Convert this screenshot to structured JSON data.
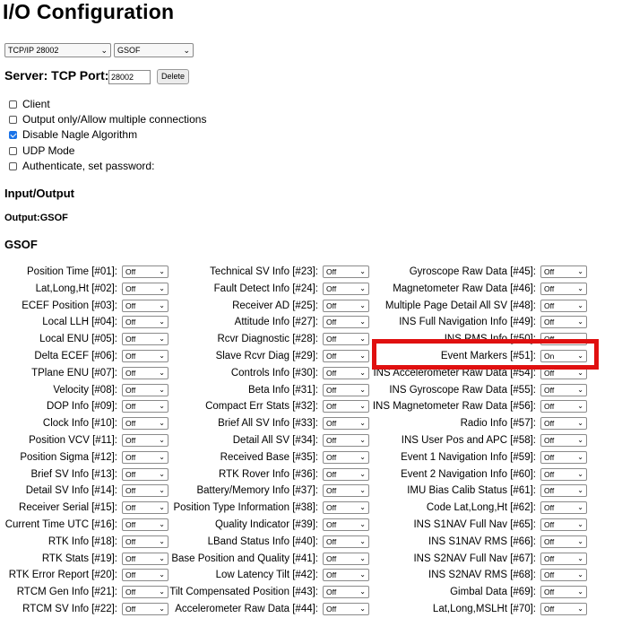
{
  "page": {
    "title": "I/O Configuration"
  },
  "top_selects": {
    "port": "TCP/IP 28002",
    "format": "GSOF"
  },
  "server": {
    "label": "Server: TCP Port:",
    "port_value": "28002",
    "delete_label": "Delete"
  },
  "checkboxes": [
    {
      "label": "Client",
      "checked": false
    },
    {
      "label": "Output only/Allow multiple connections",
      "checked": false
    },
    {
      "label": "Disable Nagle Algorithm",
      "checked": true
    },
    {
      "label": "UDP Mode",
      "checked": false
    },
    {
      "label": "Authenticate, set password:",
      "checked": false
    }
  ],
  "sections": {
    "io": "Input/Output",
    "output": "Output:GSOF",
    "gsof": "GSOF"
  },
  "columns": [
    [
      {
        "label": "Position Time [#01]:",
        "value": "Off"
      },
      {
        "label": "Lat,Long,Ht [#02]:",
        "value": "Off"
      },
      {
        "label": "ECEF Position [#03]:",
        "value": "Off"
      },
      {
        "label": "Local LLH [#04]:",
        "value": "Off"
      },
      {
        "label": "Local ENU [#05]:",
        "value": "Off"
      },
      {
        "label": "Delta ECEF [#06]:",
        "value": "Off"
      },
      {
        "label": "TPlane ENU [#07]:",
        "value": "Off"
      },
      {
        "label": "Velocity [#08]:",
        "value": "Off"
      },
      {
        "label": "DOP Info [#09]:",
        "value": "Off"
      },
      {
        "label": "Clock Info [#10]:",
        "value": "Off"
      },
      {
        "label": "Position VCV [#11]:",
        "value": "Off"
      },
      {
        "label": "Position Sigma [#12]:",
        "value": "Off"
      },
      {
        "label": "Brief SV Info [#13]:",
        "value": "Off"
      },
      {
        "label": "Detail SV Info [#14]:",
        "value": "Off"
      },
      {
        "label": "Receiver Serial [#15]:",
        "value": "Off"
      },
      {
        "label": "Current Time UTC [#16]:",
        "value": "Off"
      },
      {
        "label": "RTK Info [#18]:",
        "value": "Off"
      },
      {
        "label": "RTK Stats [#19]:",
        "value": "Off"
      },
      {
        "label": "RTK Error Report [#20]:",
        "value": "Off"
      },
      {
        "label": "RTCM Gen Info [#21]:",
        "value": "Off"
      },
      {
        "label": "RTCM SV Info [#22]:",
        "value": "Off"
      }
    ],
    [
      {
        "label": "Technical SV Info [#23]:",
        "value": "Off"
      },
      {
        "label": "Fault Detect Info [#24]:",
        "value": "Off"
      },
      {
        "label": "Receiver AD [#25]:",
        "value": "Off"
      },
      {
        "label": "Attitude Info [#27]:",
        "value": "Off"
      },
      {
        "label": "Rcvr Diagnostic [#28]:",
        "value": "Off"
      },
      {
        "label": "Slave Rcvr Diag [#29]:",
        "value": "Off"
      },
      {
        "label": "Controls Info [#30]:",
        "value": "Off"
      },
      {
        "label": "Beta Info [#31]:",
        "value": "Off"
      },
      {
        "label": "Compact Err Stats [#32]:",
        "value": "Off"
      },
      {
        "label": "Brief All SV Info [#33]:",
        "value": "Off"
      },
      {
        "label": "Detail All SV [#34]:",
        "value": "Off"
      },
      {
        "label": "Received Base [#35]:",
        "value": "Off"
      },
      {
        "label": "RTK Rover Info [#36]:",
        "value": "Off"
      },
      {
        "label": "Battery/Memory Info [#37]:",
        "value": "Off"
      },
      {
        "label": "Position Type Information [#38]:",
        "value": "Off"
      },
      {
        "label": "Quality Indicator [#39]:",
        "value": "Off"
      },
      {
        "label": "LBand Status Info [#40]:",
        "value": "Off"
      },
      {
        "label": "Base Position and Quality [#41]:",
        "value": "Off"
      },
      {
        "label": "Low Latency Tilt [#42]:",
        "value": "Off"
      },
      {
        "label": "Tilt Compensated Position [#43]:",
        "value": "Off"
      },
      {
        "label": "Accelerometer Raw Data [#44]:",
        "value": "Off"
      }
    ],
    [
      {
        "label": "Gyroscope Raw Data [#45]:",
        "value": "Off"
      },
      {
        "label": "Magnetometer Raw Data [#46]:",
        "value": "Off"
      },
      {
        "label": "Multiple Page Detail All SV [#48]:",
        "value": "Off"
      },
      {
        "label": "INS Full Navigation Info [#49]:",
        "value": "Off"
      },
      {
        "label": "INS RMS Info [#50]:",
        "value": "Off"
      },
      {
        "label": "Event Markers [#51]:",
        "value": "On"
      },
      {
        "label": "INS Accelerometer Raw Data [#54]:",
        "value": "Off"
      },
      {
        "label": "INS Gyroscope Raw Data [#55]:",
        "value": "Off"
      },
      {
        "label": "INS Magnetometer Raw Data [#56]:",
        "value": "Off"
      },
      {
        "label": "Radio Info [#57]:",
        "value": "Off"
      },
      {
        "label": "INS User Pos and APC [#58]:",
        "value": "Off"
      },
      {
        "label": "Event 1 Navigation Info [#59]:",
        "value": "Off"
      },
      {
        "label": "Event 2 Navigation Info [#60]:",
        "value": "Off"
      },
      {
        "label": "IMU Bias Calib Status [#61]:",
        "value": "Off"
      },
      {
        "label": "Code Lat,Long,Ht [#62]:",
        "value": "Off"
      },
      {
        "label": "INS S1NAV Full Nav [#65]:",
        "value": "Off"
      },
      {
        "label": "INS S1NAV RMS [#66]:",
        "value": "Off"
      },
      {
        "label": "INS S2NAV Full Nav [#67]:",
        "value": "Off"
      },
      {
        "label": "INS S2NAV RMS [#68]:",
        "value": "Off"
      },
      {
        "label": "Gimbal Data [#69]:",
        "value": "Off"
      },
      {
        "label": "Lat,Long,MSLHt [#70]:",
        "value": "Off"
      }
    ]
  ],
  "highlight_color": "#e01010",
  "icons": {
    "dropdown": "chevron-down-icon",
    "check": "checkmark-icon"
  }
}
